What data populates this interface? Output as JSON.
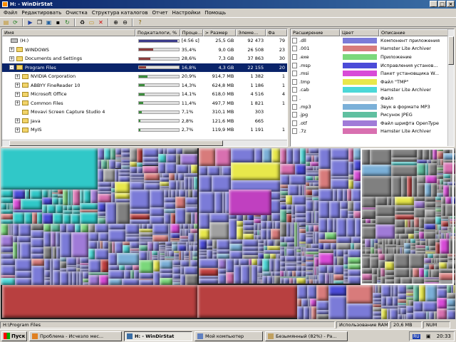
{
  "window": {
    "title": "H: - WinDirStat"
  },
  "menu": [
    "Файл",
    "Редактировать",
    "Очистка",
    "Структура каталогов",
    "Отчет",
    "Настройки",
    "Помощь"
  ],
  "toolbar_icons": [
    "open-icon",
    "refresh-icon",
    "play-icon",
    "copy-icon",
    "explorer-icon",
    "console-icon",
    "refresh-branch-icon",
    "empty-recycle-icon",
    "new-folder-icon",
    "delete-icon",
    "zoom-in-icon",
    "zoom-out-icon",
    "help-icon"
  ],
  "dir_headers": [
    "Имя",
    "Подкаталоги, %",
    "Проце...",
    "> Размер",
    "Элеме...",
    "Фа"
  ],
  "dir_rows": [
    {
      "name": "(H:)",
      "sub_pct": "[4:56 s]",
      "size": "25,5 GB",
      "elements": "92 473",
      "files": "79",
      "bar": 0.97,
      "bar_color": "#3c3c8c",
      "indent": 0,
      "expander": "",
      "icon": "drive",
      "selected": false
    },
    {
      "name": "WINDOWS",
      "sub_pct": "35,4%",
      "size": "9,0 GB",
      "elements": "26 508",
      "files": "23",
      "bar": 0.35,
      "bar_color": "#8c3c3c",
      "indent": 1,
      "expander": "+",
      "icon": "folder",
      "selected": false
    },
    {
      "name": "Documents and Settings",
      "sub_pct": "28,6%",
      "size": "7,3 GB",
      "elements": "37 863",
      "files": "30",
      "bar": 0.29,
      "bar_color": "#8c3c3c",
      "indent": 1,
      "expander": "+",
      "icon": "folder",
      "selected": false
    },
    {
      "name": "Program Files",
      "sub_pct": "16,8%",
      "size": "4,3 GB",
      "elements": "22 155",
      "files": "20",
      "bar": 0.17,
      "bar_color": "#8c3c3c",
      "indent": 1,
      "expander": "-",
      "icon": "folder",
      "selected": true
    },
    {
      "name": "NVIDIA Corporation",
      "sub_pct": "20,9%",
      "size": "914,7 MB",
      "elements": "1 382",
      "files": "1",
      "bar": 0.21,
      "bar_color": "#3c8c3c",
      "indent": 2,
      "expander": "+",
      "icon": "folder",
      "selected": false
    },
    {
      "name": "ABBYY FineReader 10",
      "sub_pct": "14,3%",
      "size": "624,8 MB",
      "elements": "1 186",
      "files": "1",
      "bar": 0.14,
      "bar_color": "#3c8c3c",
      "indent": 2,
      "expander": "+",
      "icon": "folder",
      "selected": false
    },
    {
      "name": "Microsoft Office",
      "sub_pct": "14,1%",
      "size": "618,0 MB",
      "elements": "4 516",
      "files": "4",
      "bar": 0.14,
      "bar_color": "#3c8c3c",
      "indent": 2,
      "expander": "+",
      "icon": "folder",
      "selected": false
    },
    {
      "name": "Common Files",
      "sub_pct": "11,4%",
      "size": "497,7 MB",
      "elements": "1 821",
      "files": "1",
      "bar": 0.11,
      "bar_color": "#3c8c3c",
      "indent": 2,
      "expander": "+",
      "icon": "folder",
      "selected": false
    },
    {
      "name": "Movavi Screen Capture Studio 4",
      "sub_pct": "7,1%",
      "size": "310,1 MB",
      "elements": "303",
      "files": "",
      "bar": 0.07,
      "bar_color": "#3c8c3c",
      "indent": 2,
      "expander": "",
      "icon": "folder",
      "selected": false
    },
    {
      "name": "Java",
      "sub_pct": "2,8%",
      "size": "121,6 MB",
      "elements": "665",
      "files": "",
      "bar": 0.03,
      "bar_color": "#3c8c3c",
      "indent": 2,
      "expander": "+",
      "icon": "folder",
      "selected": false
    },
    {
      "name": "MyIS",
      "sub_pct": "2,7%",
      "size": "119,9 MB",
      "elements": "1 191",
      "files": "1",
      "bar": 0.03,
      "bar_color": "#3c8c3c",
      "indent": 2,
      "expander": "+",
      "icon": "folder",
      "selected": false
    }
  ],
  "ext_headers": [
    "Расширение",
    "Цвет",
    "Описание"
  ],
  "ext_rows": [
    {
      "ext": ".dll",
      "color": "#7b7bd8",
      "desc": "Компонент приложения"
    },
    {
      "ext": ".001",
      "color": "#d87b7b",
      "desc": "Hamster Lite Archiver"
    },
    {
      "ext": ".exe",
      "color": "#7bd87b",
      "desc": "Приложение"
    },
    {
      "ext": ".msp",
      "color": "#4b4bd8",
      "desc": "Исправления установ..."
    },
    {
      "ext": ".msi",
      "color": "#d84bd8",
      "desc": "Пакет установщика W..."
    },
    {
      "ext": ".tmp",
      "color": "#e8e84b",
      "desc": "Файл \"TMP\""
    },
    {
      "ext": ".cab",
      "color": "#4bd8d8",
      "desc": "Hamster Lite Archiver"
    },
    {
      "ext": ".",
      "color": "#d8d8d8",
      "desc": "Файл"
    },
    {
      "ext": ".mp3",
      "color": "#7bb0d8",
      "desc": "Звук в формате MP3"
    },
    {
      "ext": ".jpg",
      "color": "#60c0a0",
      "desc": "Рисунок JPEG"
    },
    {
      "ext": ".otf",
      "color": "#a07bd8",
      "desc": "Файл шрифта OpenType"
    },
    {
      "ext": ".7z",
      "color": "#d870b0",
      "desc": "Hamster Lite Archiver"
    }
  ],
  "status": {
    "path": "H:\\Program Files",
    "ram_label": "Использование RAM:",
    "ram_value": "20,6 MB",
    "num": "NUM"
  },
  "taskbar": {
    "start": "Пуск",
    "tasks": [
      {
        "label": "Проблема - Исчезло мес...",
        "color": "#e08020",
        "active": false
      },
      {
        "label": "H: - WinDirStat",
        "color": "#3a6ea5",
        "active": true
      },
      {
        "label": "Мой компьютер",
        "color": "#6080c0",
        "active": false
      },
      {
        "label": "Безымянный (82%) - Pa...",
        "color": "#c0a060",
        "active": false
      }
    ],
    "lang": "RU",
    "clock": "20:33"
  }
}
